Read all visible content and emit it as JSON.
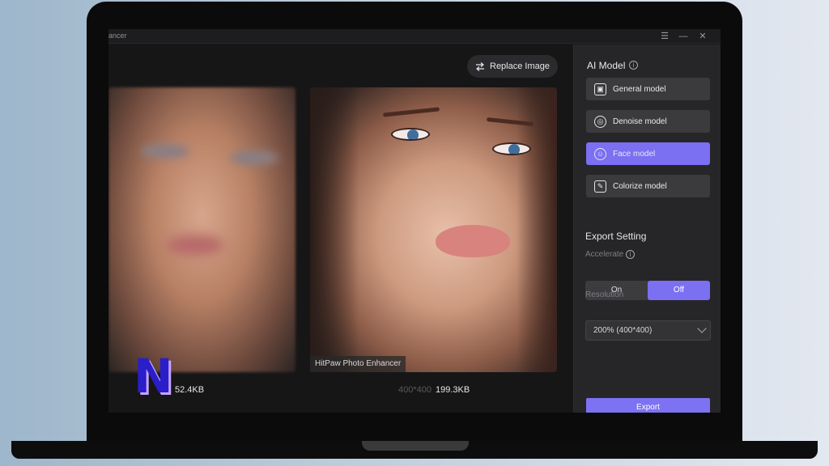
{
  "window": {
    "title": "ancer",
    "controls": [
      "☰",
      "—",
      "✕"
    ]
  },
  "toolbar": {
    "replace_label": "Replace Image",
    "replace_icon": "swap-icon"
  },
  "images": {
    "before_size": "52.4KB",
    "after_dimensions": "400*400",
    "after_size": "199.3KB",
    "watermark": "HitPaw Photo Enhancer"
  },
  "overlay_logo": "N",
  "panel": {
    "ai_model_title": "AI Model",
    "models": [
      {
        "label": "General model",
        "icon": "image-icon",
        "glyph": "▣",
        "active": false
      },
      {
        "label": "Denoise model",
        "icon": "denoise-icon",
        "glyph": "◎",
        "active": false
      },
      {
        "label": "Face model",
        "icon": "face-icon",
        "glyph": "☺",
        "active": true
      },
      {
        "label": "Colorize model",
        "icon": "colorize-icon",
        "glyph": "✎",
        "active": false
      }
    ],
    "export_setting_title": "Export Setting",
    "accelerate_label": "Accelerate",
    "accelerate_options": [
      "On",
      "Off"
    ],
    "accelerate_selected": "Off",
    "resolution_label": "Resolution",
    "resolution_value": "200% (400*400)",
    "export_label": "Export"
  },
  "colors": {
    "accent": "#7b6ff2",
    "panel_bg": "#262628",
    "canvas_bg": "#161617"
  }
}
